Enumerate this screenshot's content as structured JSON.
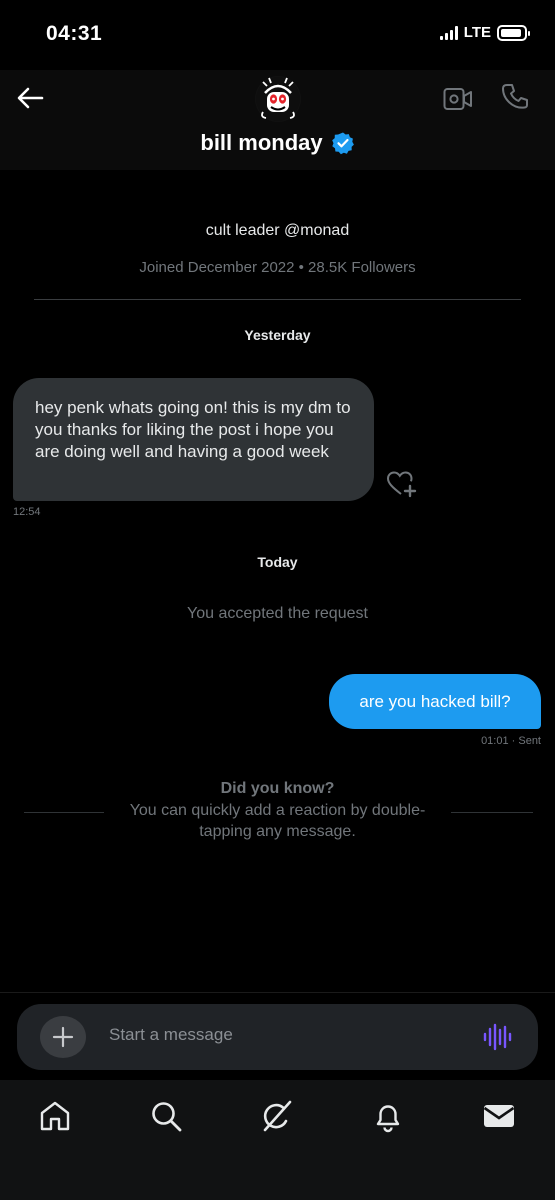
{
  "status": {
    "time": "04:31",
    "network": "LTE"
  },
  "header": {
    "name": "bill monday",
    "verified": true,
    "accent": "#1d9bf0"
  },
  "profile": {
    "bio": "cult leader @monad",
    "joined": "Joined December 2022 • 28.5K Followers"
  },
  "conversation": {
    "day1": "Yesterday",
    "incoming": {
      "text": "hey penk whats going on!  this is my dm to you thanks for liking the post i hope you are doing well and having a good week",
      "time": "12:54"
    },
    "day2": "Today",
    "accepted": "You accepted the request",
    "outgoing": {
      "text": "are you hacked bill?",
      "meta": "01:01 · Sent"
    }
  },
  "tip": {
    "title": "Did you know?",
    "text": "You can quickly add a reaction by double-tapping any message."
  },
  "composer": {
    "placeholder": "Start a message"
  },
  "tabs": [
    "home",
    "search",
    "grok",
    "notifications",
    "messages"
  ],
  "colors": {
    "bubble_in": "#2f3336",
    "bubble_out": "#1d9bf0",
    "voice": "#7856ff"
  }
}
